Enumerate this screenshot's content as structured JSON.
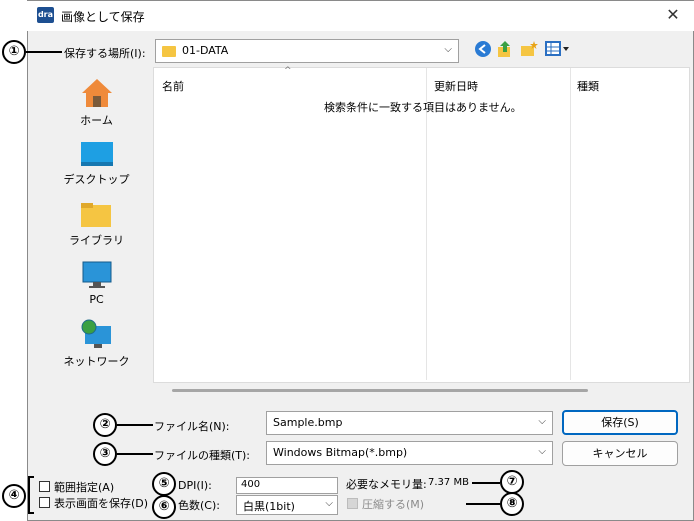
{
  "window": {
    "app_icon_text": "dra",
    "title": "画像として保存",
    "close": "✕"
  },
  "save_in": {
    "label": "保存する場所(I):",
    "value": "01-DATA"
  },
  "places": [
    {
      "label": "ホーム",
      "icon": "home-icon"
    },
    {
      "label": "デスクトップ",
      "icon": "desktop-icon"
    },
    {
      "label": "ライブラリ",
      "icon": "library-icon"
    },
    {
      "label": "PC",
      "icon": "pc-icon"
    },
    {
      "label": "ネットワーク",
      "icon": "network-icon"
    }
  ],
  "filelist": {
    "columns": [
      "名前",
      "更新日時",
      "種類"
    ],
    "empty_message": "検索条件に一致する項目はありません。"
  },
  "filename": {
    "label": "ファイル名(N):",
    "value": "Sample.bmp"
  },
  "filetype": {
    "label": "ファイルの種類(T):",
    "value": "Windows Bitmap(*.bmp)"
  },
  "buttons": {
    "save": "保存(S)",
    "cancel": "キャンセル"
  },
  "options": {
    "range": "範囲指定(A)",
    "save_display": "表示画面を保存(D)",
    "dpi_label": "DPI(I):",
    "dpi_value": "400",
    "colors_label": "色数(C):",
    "colors_value": "白黒(1bit)",
    "memory_label": "必要なメモリ量:",
    "memory_value": "7.37 MB",
    "compress": "圧縮する(M)"
  },
  "callouts": [
    "①",
    "②",
    "③",
    "④",
    "⑤",
    "⑥",
    "⑦",
    "⑧"
  ],
  "colors": {
    "accent": "#0067c0",
    "dialog_bg": "#f0f0f0",
    "folder": "#f5c542"
  }
}
